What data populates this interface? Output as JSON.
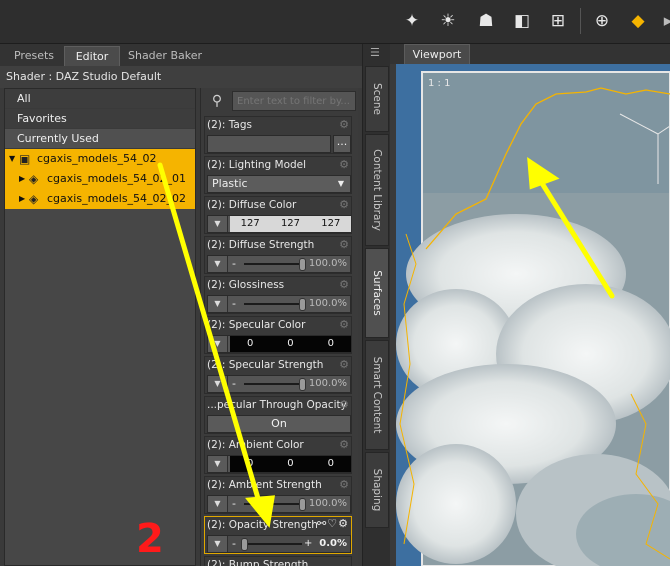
{
  "toolbar": {
    "icons": [
      "node-light-icon",
      "sun-icon",
      "figure-group-icon",
      "object-tools-icon",
      "morph-tool-icon",
      "dform-icon",
      "universal-tool-icon",
      "render-tool-icon"
    ]
  },
  "tabs": {
    "presets": "Presets",
    "editor": "Editor",
    "shader_baker": "Shader Baker"
  },
  "shader_line": "Shader : DAZ Studio Default",
  "tree": {
    "categories": [
      "All",
      "Favorites",
      "Currently Used"
    ],
    "root": "cgaxis_models_54_02",
    "children": [
      "cgaxis_models_54_02_01",
      "cgaxis_models_54_02_02"
    ]
  },
  "filter": {
    "placeholder": "Enter text to filter by..."
  },
  "properties": {
    "tags": {
      "label": "(2): Tags",
      "button": "..."
    },
    "lighting_model": {
      "label": "(2): Lighting Model",
      "value": "Plastic"
    },
    "diffuse_color": {
      "label": "(2): Diffuse Color",
      "r": "127",
      "g": "127",
      "b": "127"
    },
    "diffuse_strength": {
      "label": "(2): Diffuse Strength",
      "value": "100.0%",
      "fraction": 1.0
    },
    "glossiness": {
      "label": "(2): Glossiness",
      "value": "100.0%",
      "fraction": 1.0
    },
    "specular_color": {
      "label": "(2): Specular Color",
      "r": "0",
      "g": "0",
      "b": "0"
    },
    "specular_strength": {
      "label": "(2): Specular Strength",
      "value": "100.0%",
      "fraction": 1.0
    },
    "multiply_through_opacity": {
      "label": "...pecular Through Opacity",
      "value": "On"
    },
    "ambient_color": {
      "label": "(2): Ambient Color",
      "r": "0",
      "g": "0",
      "b": "0"
    },
    "ambient_strength": {
      "label": "(2): Ambient Strength",
      "value": "100.0%",
      "fraction": 1.0
    },
    "opacity_strength": {
      "label": "(2): Opacity Strength",
      "value": "0.0%",
      "fraction": 0.0
    },
    "bump_strength": {
      "label": "(2): Bump Strength"
    }
  },
  "vertical_tabs": [
    "Scene",
    "Content Library",
    "Surfaces",
    "Smart Content",
    "Shaping"
  ],
  "viewport": {
    "tab": "Viewport",
    "zoom": "1 : 1"
  },
  "annotation": {
    "number": "2",
    "arrow_color": "#ffff00",
    "number_color": "#ff1a1a"
  },
  "colors": {
    "accent": "#f5b400",
    "sky": "#3a6fa0"
  }
}
